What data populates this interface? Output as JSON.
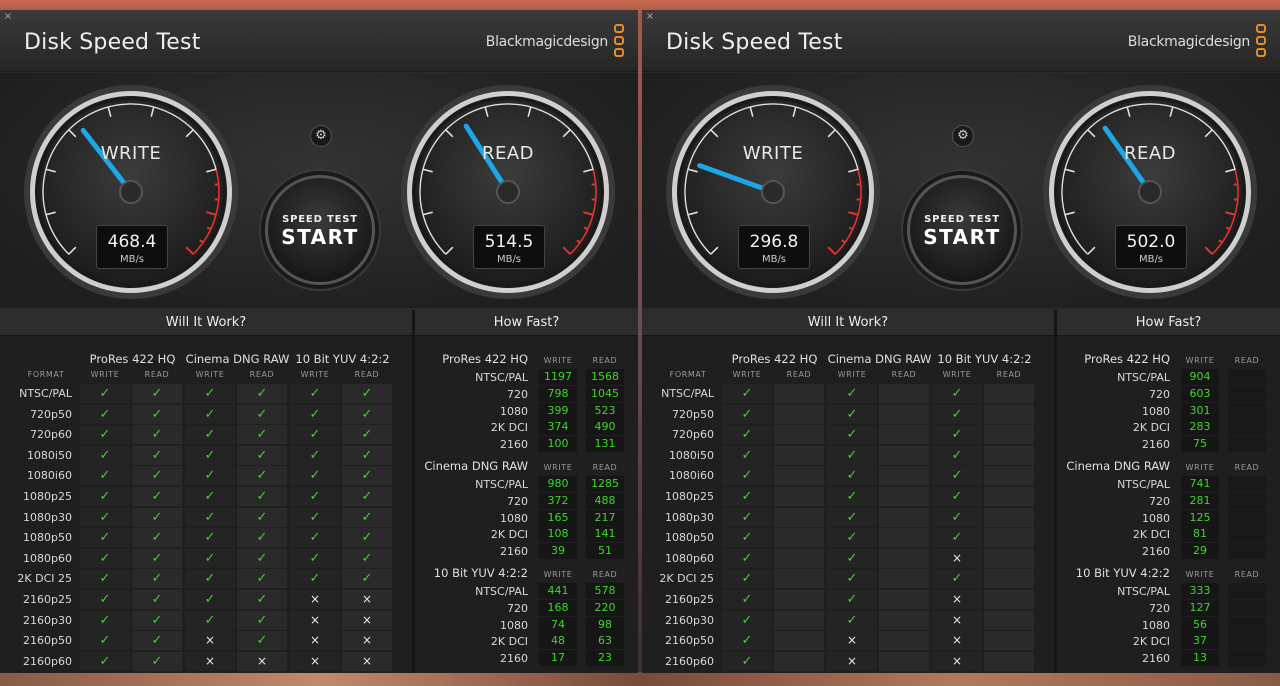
{
  "colors": {
    "check": "#3ed62a",
    "needle": "#1ea7e8",
    "brand_accent": "#e38b2b",
    "redline": "#e5342a"
  },
  "windows": [
    {
      "title": "Disk Speed Test",
      "brand": "Blackmagicdesign",
      "close_icon": "×",
      "settings_icon": "⚙",
      "write": {
        "label": "WRITE",
        "value": "468.4",
        "unit": "MB/s",
        "needle_fraction": 0.36
      },
      "read": {
        "label": "READ",
        "value": "514.5",
        "unit": "MB/s",
        "needle_fraction": 0.38
      },
      "start": {
        "line1": "SPEED TEST",
        "line2": "START"
      },
      "will_it_work": {
        "heading": "Will It Work?",
        "format_label": "FORMAT",
        "groups": [
          "ProRes 422 HQ",
          "Cinema DNG RAW",
          "10 Bit YUV 4:2:2"
        ],
        "write_label": "WRITE",
        "read_label": "READ",
        "rows": [
          {
            "format": "NTSC/PAL",
            "marks": [
              "✓",
              "✓",
              "✓",
              "✓",
              "✓",
              "✓"
            ]
          },
          {
            "format": "720p50",
            "marks": [
              "✓",
              "✓",
              "✓",
              "✓",
              "✓",
              "✓"
            ]
          },
          {
            "format": "720p60",
            "marks": [
              "✓",
              "✓",
              "✓",
              "✓",
              "✓",
              "✓"
            ]
          },
          {
            "format": "1080i50",
            "marks": [
              "✓",
              "✓",
              "✓",
              "✓",
              "✓",
              "✓"
            ]
          },
          {
            "format": "1080i60",
            "marks": [
              "✓",
              "✓",
              "✓",
              "✓",
              "✓",
              "✓"
            ]
          },
          {
            "format": "1080p25",
            "marks": [
              "✓",
              "✓",
              "✓",
              "✓",
              "✓",
              "✓"
            ]
          },
          {
            "format": "1080p30",
            "marks": [
              "✓",
              "✓",
              "✓",
              "✓",
              "✓",
              "✓"
            ]
          },
          {
            "format": "1080p50",
            "marks": [
              "✓",
              "✓",
              "✓",
              "✓",
              "✓",
              "✓"
            ]
          },
          {
            "format": "1080p60",
            "marks": [
              "✓",
              "✓",
              "✓",
              "✓",
              "✓",
              "✓"
            ]
          },
          {
            "format": "2K DCI 25",
            "marks": [
              "✓",
              "✓",
              "✓",
              "✓",
              "✓",
              "✓"
            ]
          },
          {
            "format": "2160p25",
            "marks": [
              "✓",
              "✓",
              "✓",
              "✓",
              "×",
              "×"
            ]
          },
          {
            "format": "2160p30",
            "marks": [
              "✓",
              "✓",
              "✓",
              "✓",
              "×",
              "×"
            ]
          },
          {
            "format": "2160p50",
            "marks": [
              "✓",
              "✓",
              "×",
              "✓",
              "×",
              "×"
            ]
          },
          {
            "format": "2160p60",
            "marks": [
              "✓",
              "✓",
              "×",
              "×",
              "×",
              "×"
            ]
          }
        ]
      },
      "how_fast": {
        "heading": "How Fast?",
        "write_label": "WRITE",
        "read_label": "READ",
        "groups": [
          {
            "name": "ProRes 422 HQ",
            "rows": [
              {
                "format": "NTSC/PAL",
                "write": "1197",
                "read": "1568"
              },
              {
                "format": "720",
                "write": "798",
                "read": "1045"
              },
              {
                "format": "1080",
                "write": "399",
                "read": "523"
              },
              {
                "format": "2K DCI",
                "write": "374",
                "read": "490"
              },
              {
                "format": "2160",
                "write": "100",
                "read": "131"
              }
            ]
          },
          {
            "name": "Cinema DNG RAW",
            "rows": [
              {
                "format": "NTSC/PAL",
                "write": "980",
                "read": "1285"
              },
              {
                "format": "720",
                "write": "372",
                "read": "488"
              },
              {
                "format": "1080",
                "write": "165",
                "read": "217"
              },
              {
                "format": "2K DCI",
                "write": "108",
                "read": "141"
              },
              {
                "format": "2160",
                "write": "39",
                "read": "51"
              }
            ]
          },
          {
            "name": "10 Bit YUV 4:2:2",
            "rows": [
              {
                "format": "NTSC/PAL",
                "write": "441",
                "read": "578"
              },
              {
                "format": "720",
                "write": "168",
                "read": "220"
              },
              {
                "format": "1080",
                "write": "74",
                "read": "98"
              },
              {
                "format": "2K DCI",
                "write": "48",
                "read": "63"
              },
              {
                "format": "2160",
                "write": "17",
                "read": "23"
              }
            ]
          }
        ]
      }
    },
    {
      "title": "Disk Speed Test",
      "brand": "Blackmagicdesign",
      "close_icon": "×",
      "settings_icon": "⚙",
      "write": {
        "label": "WRITE",
        "value": "296.8",
        "unit": "MB/s",
        "needle_fraction": 0.24
      },
      "read": {
        "label": "READ",
        "value": "502.0",
        "unit": "MB/s",
        "needle_fraction": 0.37
      },
      "start": {
        "line1": "SPEED TEST",
        "line2": "START"
      },
      "will_it_work": {
        "heading": "Will It Work?",
        "format_label": "FORMAT",
        "groups": [
          "ProRes 422 HQ",
          "Cinema DNG RAW",
          "10 Bit YUV 4:2:2"
        ],
        "write_label": "WRITE",
        "read_label": "READ",
        "rows": [
          {
            "format": "NTSC/PAL",
            "marks": [
              "✓",
              "",
              "✓",
              "",
              "✓",
              ""
            ]
          },
          {
            "format": "720p50",
            "marks": [
              "✓",
              "",
              "✓",
              "",
              "✓",
              ""
            ]
          },
          {
            "format": "720p60",
            "marks": [
              "✓",
              "",
              "✓",
              "",
              "✓",
              ""
            ]
          },
          {
            "format": "1080i50",
            "marks": [
              "✓",
              "",
              "✓",
              "",
              "✓",
              ""
            ]
          },
          {
            "format": "1080i60",
            "marks": [
              "✓",
              "",
              "✓",
              "",
              "✓",
              ""
            ]
          },
          {
            "format": "1080p25",
            "marks": [
              "✓",
              "",
              "✓",
              "",
              "✓",
              ""
            ]
          },
          {
            "format": "1080p30",
            "marks": [
              "✓",
              "",
              "✓",
              "",
              "✓",
              ""
            ]
          },
          {
            "format": "1080p50",
            "marks": [
              "✓",
              "",
              "✓",
              "",
              "✓",
              ""
            ]
          },
          {
            "format": "1080p60",
            "marks": [
              "✓",
              "",
              "✓",
              "",
              "×",
              ""
            ]
          },
          {
            "format": "2K DCI 25",
            "marks": [
              "✓",
              "",
              "✓",
              "",
              "✓",
              ""
            ]
          },
          {
            "format": "2160p25",
            "marks": [
              "✓",
              "",
              "✓",
              "",
              "×",
              ""
            ]
          },
          {
            "format": "2160p30",
            "marks": [
              "✓",
              "",
              "✓",
              "",
              "×",
              ""
            ]
          },
          {
            "format": "2160p50",
            "marks": [
              "✓",
              "",
              "×",
              "",
              "×",
              ""
            ]
          },
          {
            "format": "2160p60",
            "marks": [
              "✓",
              "",
              "×",
              "",
              "×",
              ""
            ]
          }
        ]
      },
      "how_fast": {
        "heading": "How Fast?",
        "write_label": "WRITE",
        "read_label": "READ",
        "groups": [
          {
            "name": "ProRes 422 HQ",
            "rows": [
              {
                "format": "NTSC/PAL",
                "write": "904",
                "read": ""
              },
              {
                "format": "720",
                "write": "603",
                "read": ""
              },
              {
                "format": "1080",
                "write": "301",
                "read": ""
              },
              {
                "format": "2K DCI",
                "write": "283",
                "read": ""
              },
              {
                "format": "2160",
                "write": "75",
                "read": ""
              }
            ]
          },
          {
            "name": "Cinema DNG RAW",
            "rows": [
              {
                "format": "NTSC/PAL",
                "write": "741",
                "read": ""
              },
              {
                "format": "720",
                "write": "281",
                "read": ""
              },
              {
                "format": "1080",
                "write": "125",
                "read": ""
              },
              {
                "format": "2K DCI",
                "write": "81",
                "read": ""
              },
              {
                "format": "2160",
                "write": "29",
                "read": ""
              }
            ]
          },
          {
            "name": "10 Bit YUV 4:2:2",
            "rows": [
              {
                "format": "NTSC/PAL",
                "write": "333",
                "read": ""
              },
              {
                "format": "720",
                "write": "127",
                "read": ""
              },
              {
                "format": "1080",
                "write": "56",
                "read": ""
              },
              {
                "format": "2K DCI",
                "write": "37",
                "read": ""
              },
              {
                "format": "2160",
                "write": "13",
                "read": ""
              }
            ]
          }
        ]
      }
    }
  ]
}
